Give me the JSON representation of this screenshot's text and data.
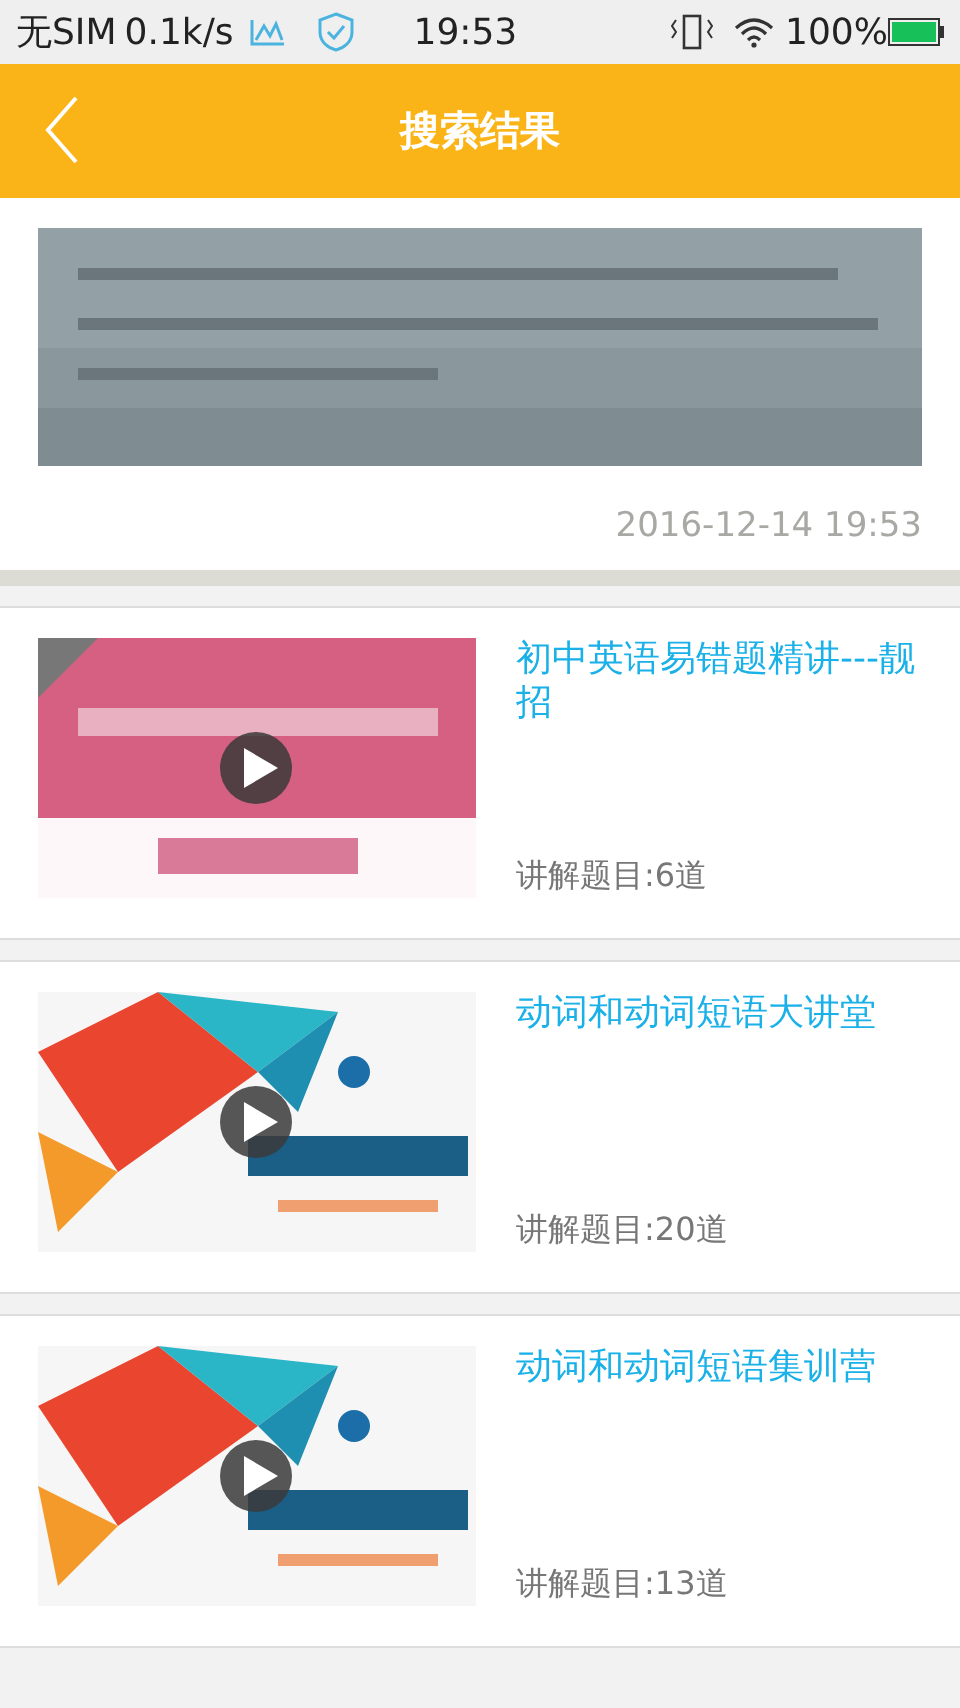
{
  "status_bar": {
    "carrier": "无SIM",
    "speed": "0.1k/s",
    "time": "19:53",
    "battery": "100%"
  },
  "header": {
    "title": "搜索结果"
  },
  "top_card": {
    "date": "2016-12-14 19:53"
  },
  "results": [
    {
      "title": "初中英语易错题精讲---靓招",
      "count": "讲解题目:6道",
      "kind": "pink"
    },
    {
      "title": "动词和动词短语大讲堂",
      "count": "讲解题目:20道",
      "kind": "poly"
    },
    {
      "title": "动词和动词短语集训营",
      "count": "讲解题目:13道",
      "kind": "poly"
    }
  ]
}
